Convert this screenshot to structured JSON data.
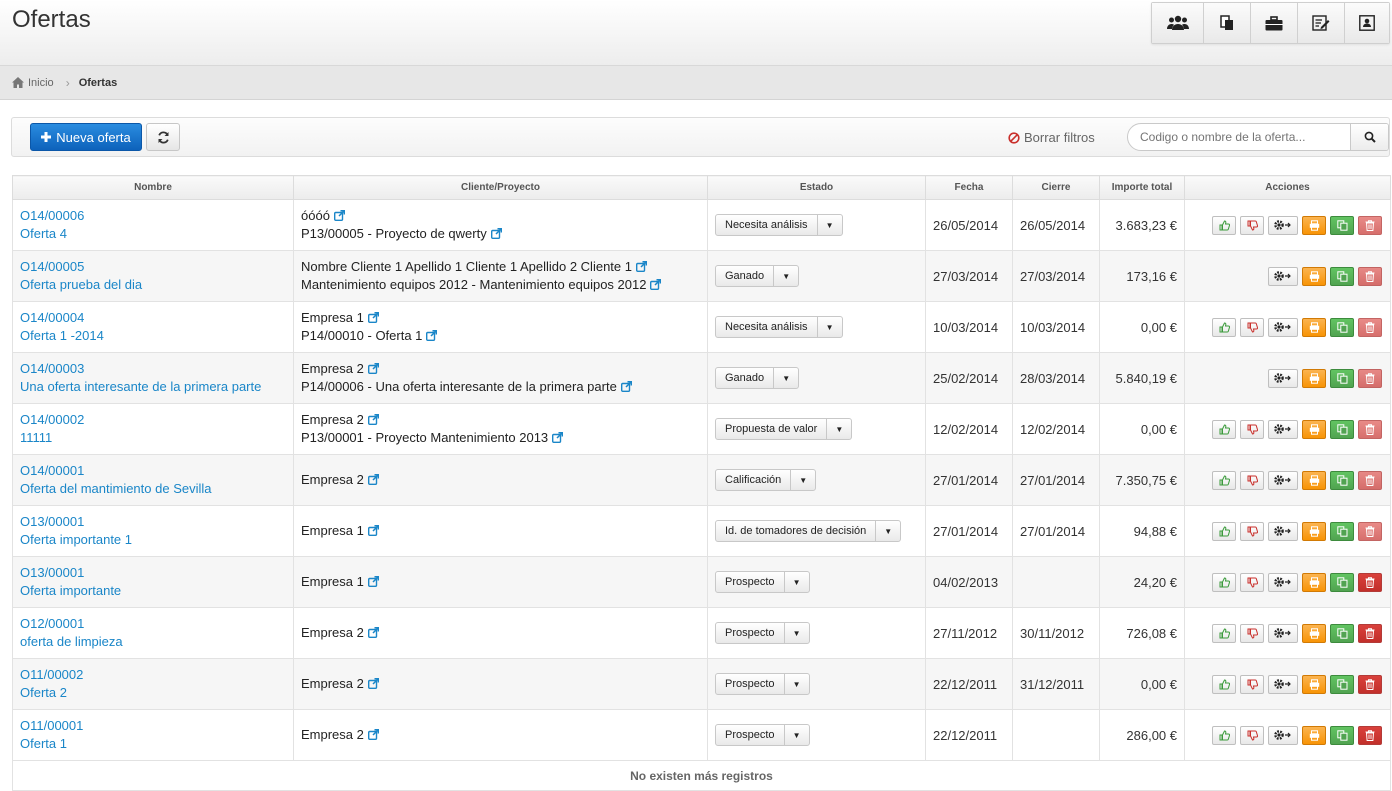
{
  "page": {
    "title": "Ofertas"
  },
  "header_icons": [
    {
      "name": "users-icon"
    },
    {
      "name": "documents-icon"
    },
    {
      "name": "briefcase-icon"
    },
    {
      "name": "edit-list-icon"
    },
    {
      "name": "contact-card-icon"
    }
  ],
  "breadcrumb": {
    "home": "Inicio",
    "current": "Ofertas"
  },
  "toolbar": {
    "new_label": "Nueva oferta",
    "clear_filters": "Borrar filtros",
    "search_placeholder": "Codigo o nombre de la oferta..."
  },
  "table": {
    "headers": [
      "Nombre",
      "Cliente/Proyecto",
      "Estado",
      "Fecha",
      "Cierre",
      "Importe total",
      "Acciones"
    ],
    "rows": [
      {
        "code": "O14/00006",
        "name": "Oferta 4",
        "cliente": "óóóó",
        "proyecto": "P13/00005 - Proyecto de qwerty",
        "estado": "Necesita análisis",
        "fecha": "26/05/2014",
        "cierre": "26/05/2014",
        "importe": "3.683,23 €",
        "vote": true,
        "del_active": false
      },
      {
        "code": "O14/00005",
        "name": "Oferta prueba del dia",
        "cliente": "Nombre Cliente 1 Apellido 1 Cliente 1 Apellido 2 Cliente 1",
        "proyecto": "Mantenimiento equipos 2012 - Mantenimiento equipos 2012",
        "estado": "Ganado",
        "fecha": "27/03/2014",
        "cierre": "27/03/2014",
        "importe": "173,16 €",
        "vote": false,
        "del_active": false
      },
      {
        "code": "O14/00004",
        "name": "Oferta 1 -2014",
        "cliente": "Empresa 1",
        "proyecto": "P14/00010 - Oferta 1",
        "estado": "Necesita análisis",
        "fecha": "10/03/2014",
        "cierre": "10/03/2014",
        "importe": "0,00 €",
        "vote": true,
        "del_active": false
      },
      {
        "code": "O14/00003",
        "name": "Una oferta interesante de la primera parte",
        "cliente": "Empresa 2",
        "proyecto": "P14/00006 - Una oferta interesante de la primera parte",
        "estado": "Ganado",
        "fecha": "25/02/2014",
        "cierre": "28/03/2014",
        "importe": "5.840,19 €",
        "vote": false,
        "del_active": false
      },
      {
        "code": "O14/00002",
        "name": "11111",
        "cliente": "Empresa 2",
        "proyecto": "P13/00001 - Proyecto Mantenimiento 2013",
        "estado": "Propuesta de valor",
        "fecha": "12/02/2014",
        "cierre": "12/02/2014",
        "importe": "0,00 €",
        "vote": true,
        "del_active": false
      },
      {
        "code": "O14/00001",
        "name": "Oferta del mantimiento de Sevilla",
        "cliente": "Empresa 2",
        "proyecto": "",
        "estado": "Calificación",
        "fecha": "27/01/2014",
        "cierre": "27/01/2014",
        "importe": "7.350,75 €",
        "vote": true,
        "del_active": false
      },
      {
        "code": "O13/00001",
        "name": "Oferta importante 1",
        "cliente": "Empresa 1",
        "proyecto": "",
        "estado": "Id. de tomadores de decisión",
        "fecha": "27/01/2014",
        "cierre": "27/01/2014",
        "importe": "94,88 €",
        "vote": true,
        "del_active": false
      },
      {
        "code": "O13/00001",
        "name": "Oferta importante",
        "cliente": "Empresa 1",
        "proyecto": "",
        "estado": "Prospecto",
        "fecha": "04/02/2013",
        "cierre": "",
        "importe": "24,20 €",
        "vote": true,
        "del_active": true
      },
      {
        "code": "O12/00001",
        "name": "oferta de limpieza",
        "cliente": "Empresa 2",
        "proyecto": "",
        "estado": "Prospecto",
        "fecha": "27/11/2012",
        "cierre": "30/11/2012",
        "importe": "726,08 €",
        "vote": true,
        "del_active": true
      },
      {
        "code": "O11/00002",
        "name": "Oferta 2",
        "cliente": "Empresa 2",
        "proyecto": "",
        "estado": "Prospecto",
        "fecha": "22/12/2011",
        "cierre": "31/12/2011",
        "importe": "0,00 €",
        "vote": true,
        "del_active": true
      },
      {
        "code": "O11/00001",
        "name": "Oferta 1",
        "cliente": "Empresa 2",
        "proyecto": "",
        "estado": "Prospecto",
        "fecha": "22/12/2011",
        "cierre": "",
        "importe": "286,00 €",
        "vote": true,
        "del_active": true
      }
    ],
    "footer": "No existen más registros"
  },
  "colors": {
    "primary": "#0d62bb",
    "link": "#1a86c8",
    "print": "#f89406",
    "copy": "#51a351",
    "delete": "#cc4744",
    "thumb_up": "#3a9a3a",
    "thumb_down": "#c9302c"
  }
}
